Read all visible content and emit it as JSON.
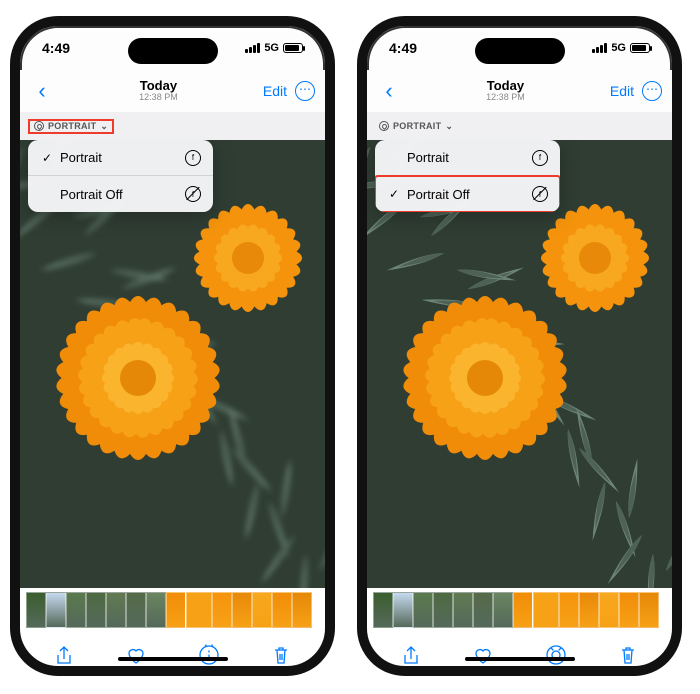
{
  "phones": [
    {
      "status": {
        "time": "4:49",
        "net": "5G"
      },
      "nav": {
        "title": "Today",
        "subtitle": "12:38 PM",
        "edit": "Edit"
      },
      "badge": {
        "label": "PORTRAIT",
        "dropdown_glyph": "⌄",
        "highlighted": true
      },
      "menu": {
        "highlighted_row": null,
        "items": [
          {
            "checked": true,
            "label": "Portrait",
            "icon": "aperture"
          },
          {
            "checked": false,
            "label": "Portrait Off",
            "icon": "aperture-off"
          }
        ]
      },
      "photo_blur": true
    },
    {
      "status": {
        "time": "4:49",
        "net": "5G"
      },
      "nav": {
        "title": "Today",
        "subtitle": "12:38 PM",
        "edit": "Edit"
      },
      "badge": {
        "label": "PORTRAIT",
        "dropdown_glyph": "⌄",
        "highlighted": false
      },
      "menu": {
        "highlighted_row": 1,
        "items": [
          {
            "checked": false,
            "label": "Portrait",
            "icon": "aperture"
          },
          {
            "checked": true,
            "label": "Portrait Off",
            "icon": "aperture-off"
          }
        ]
      },
      "photo_blur": false
    }
  ],
  "thumbs_count": 14
}
